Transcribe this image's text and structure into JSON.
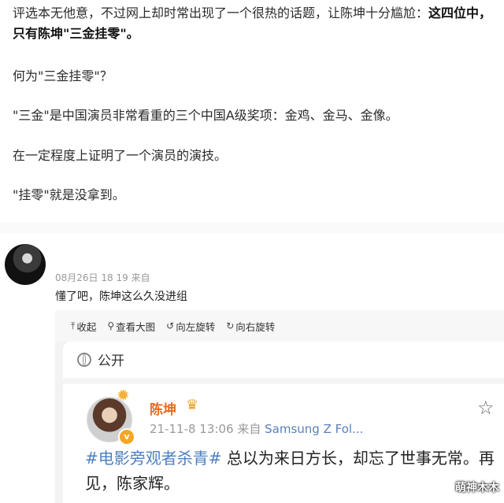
{
  "article": {
    "p1_normal": "评选本无他意，不过网上却时常出现了一个很热的话题，让陈坤十分尴尬：",
    "p1_bold": "这四位中，只有陈坤\"三金挂零\"。",
    "p2": "何为\"三金挂零\"？",
    "p3": "\"三金\"是中国演员非常看重的三个中国A级奖项：金鸡、金马、金像。",
    "p4": "在一定程度上证明了一个演员的演技。",
    "p5": "\"挂零\"就是没拿到。"
  },
  "comment": {
    "meta": "08月26日 18 19  来自",
    "text": "懂了吧，陈坤这么久没进组"
  },
  "viewer": {
    "toolbar": [
      {
        "icon": "collapse-icon",
        "glyph": "⤒",
        "label": "收起"
      },
      {
        "icon": "zoom-icon",
        "glyph": "⚲",
        "label": "查看大图"
      },
      {
        "icon": "rotate-left-icon",
        "glyph": "↺",
        "label": "向左旋转"
      },
      {
        "icon": "rotate-right-icon",
        "glyph": "↻",
        "label": "向右旋转"
      }
    ]
  },
  "post": {
    "visibility": "公开",
    "author": "陈坤",
    "verified_badge": "v",
    "time": "21-11-8 13:06",
    "source_prefix": "来自",
    "device": "Samsung Z Fol...",
    "hashtag": "#电影旁观者杀青#",
    "body": " 总以为来日方长，却忘了世事无常。再见，陈家辉。"
  },
  "watermark": "萌神木木"
}
